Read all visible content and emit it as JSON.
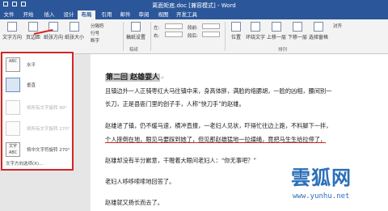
{
  "window": {
    "title": "离面矩底.doc [兼容模式] - Word"
  },
  "tabs": [
    "文件",
    "开始",
    "插入",
    "设计",
    "布局",
    "引用",
    "邮件",
    "审阅",
    "视图",
    "开发工具"
  ],
  "active_tab": "布局",
  "ribbon": {
    "text_direction": "文字方向",
    "margins": "页边距",
    "orientation": "纸张方向",
    "size": "纸张大小",
    "breaks": "分隔符",
    "line_numbers": "行号",
    "hyphenation": "断字",
    "draft": "稿纸设置",
    "indent_left": "左:",
    "indent_right": "右:",
    "spacing_before": "段前:",
    "spacing_after": "段后:",
    "position": "位置",
    "wrap": "环绕文字",
    "bring_forward": "上移一层",
    "send_backward": "下移一层",
    "selection_pane": "选择窗格",
    "align": "对齐",
    "group_paper": "稿纸",
    "group_arrange": "排列"
  },
  "dropdown": {
    "items": [
      {
        "label": "水平",
        "icon": "ABC",
        "disabled": false,
        "selected": false
      },
      {
        "label": "垂直",
        "icon": "",
        "disabled": false,
        "selected": true
      },
      {
        "label": "将所有文字旋转 90°",
        "icon": "",
        "disabled": true,
        "selected": false
      },
      {
        "label": "将所有文字旋转 270°",
        "icon": "",
        "disabled": true,
        "selected": false
      },
      {
        "label": "将中文字符旋转 270°",
        "icon": "文字ABC",
        "disabled": false,
        "selected": false
      }
    ],
    "footer": "文字方向选项(X)..."
  },
  "document": {
    "heading": "第二回  赵雄耍人",
    "paragraphs": [
      "且镇边外一人正骑枣红大马往镇中来，身高体胖，满脸的络腮胡，一脸的凶相，腰间别一",
      "长刀，正是县衙门里的刽子手，人称“快刀手”的赵雄。",
      "赵雄进了镇，仍不缓马速，横冲直撞，一老妇人见状，吓得忙往边上跑，不料脚下一拌，",
      "个人摔倒在地，眼见马要踩到她了，但见那赵雄猛地一拉缰绳，竟把马生生给拉停了，",
      "赵雄却没有半分歉意，干瞪着大眼问老妇人：“你无事吧？”",
      "老妇人哆哆嗦嗦地回答了。",
      "赵雄就又扬长而去了。"
    ]
  },
  "watermark": {
    "cn": "雲狐网",
    "url": "www.yunhu.net"
  }
}
